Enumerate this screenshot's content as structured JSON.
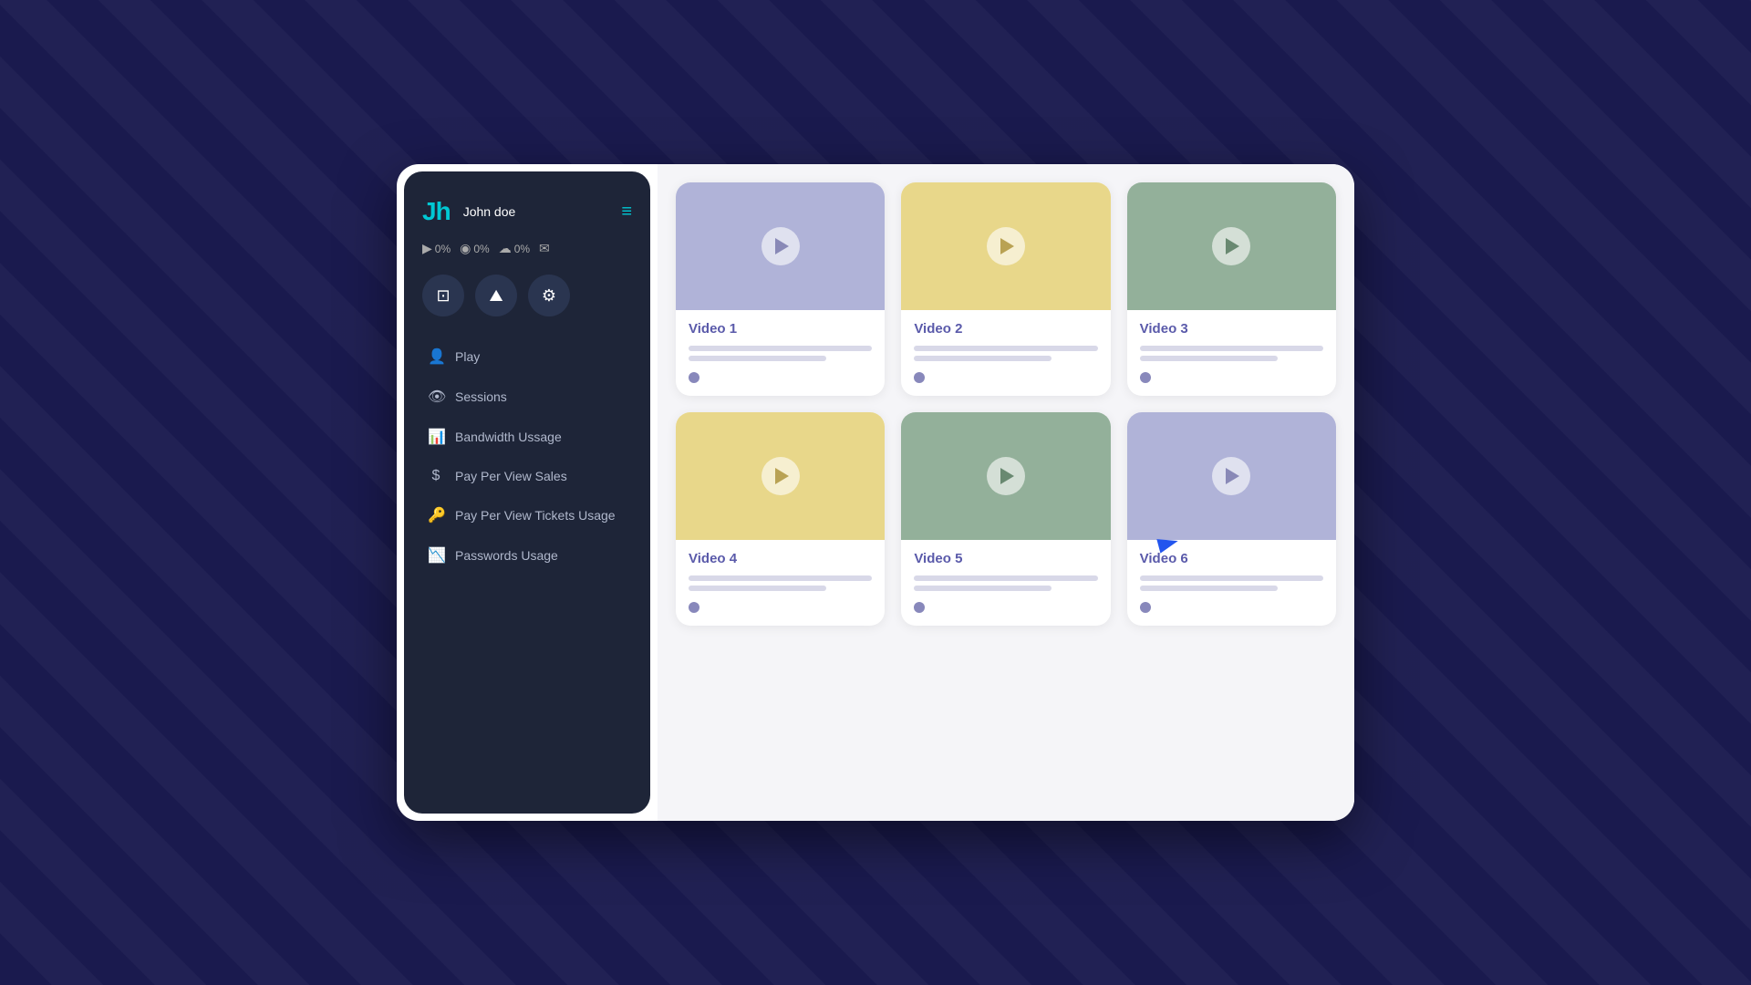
{
  "sidebar": {
    "logo": "Jh",
    "username": "John doe",
    "stats": [
      {
        "icon": "▶",
        "value": "0%",
        "name": "play-stat"
      },
      {
        "icon": "◉",
        "value": "0%",
        "name": "sessions-stat"
      },
      {
        "icon": "☁",
        "value": "0%",
        "name": "bandwidth-stat"
      }
    ],
    "iconTabs": [
      {
        "icon": "⊡",
        "name": "video-tab",
        "active": true
      },
      {
        "icon": "⛰",
        "name": "analytics-tab",
        "active": false
      },
      {
        "icon": "⚙",
        "name": "settings-tab",
        "active": false
      }
    ],
    "navItems": [
      {
        "icon": "👤",
        "label": "Play",
        "name": "nav-play"
      },
      {
        "icon": "👁",
        "label": "Sessions",
        "name": "nav-sessions"
      },
      {
        "icon": "📊",
        "label": "Bandwidth Ussage",
        "name": "nav-bandwidth"
      },
      {
        "icon": "$",
        "label": "Pay Per View Sales",
        "name": "nav-ppv-sales"
      },
      {
        "icon": "🔑",
        "label": "Pay Per View Tickets Usage",
        "name": "nav-ppv-tickets"
      },
      {
        "icon": "📉",
        "label": "Passwords Usage",
        "name": "nav-passwords"
      }
    ]
  },
  "videos": [
    {
      "id": 1,
      "title": "Video 1",
      "thumb": "purple",
      "name": "video-card-1"
    },
    {
      "id": 2,
      "title": "Video 2",
      "thumb": "yellow",
      "name": "video-card-2"
    },
    {
      "id": 3,
      "title": "Video 3",
      "thumb": "green",
      "name": "video-card-3"
    },
    {
      "id": 4,
      "title": "Video 4",
      "thumb": "yellow",
      "name": "video-card-4"
    },
    {
      "id": 5,
      "title": "Video 5",
      "thumb": "green",
      "name": "video-card-5"
    },
    {
      "id": 6,
      "title": "Video 6",
      "thumb": "purple",
      "name": "video-card-6"
    }
  ],
  "icons": {
    "hamburger": "≡",
    "play": "▶",
    "sessions": "◉",
    "cloud": "☁",
    "mail": "✉"
  }
}
